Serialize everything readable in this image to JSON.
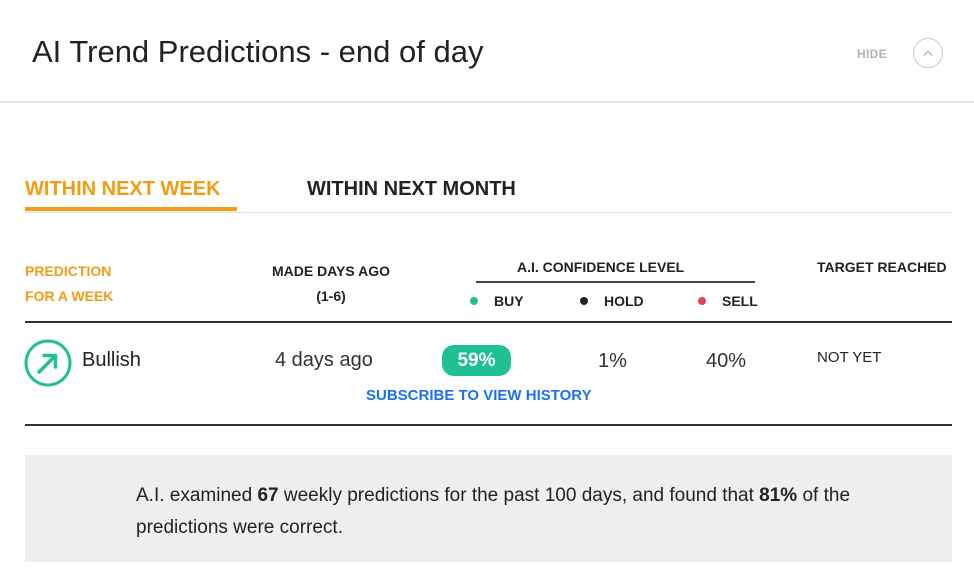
{
  "header": {
    "title": "AI Trend Predictions - end of day",
    "hide_label": "HIDE",
    "collapse_icon": "chevron-up-icon"
  },
  "tabs": [
    {
      "label": "WITHIN NEXT WEEK",
      "active": true
    },
    {
      "label": "WITHIN NEXT MONTH",
      "active": false
    }
  ],
  "columns": {
    "prediction_line1": "PREDICTION",
    "prediction_line2": "FOR A WEEK",
    "made_days_ago_line1": "MADE DAYS AGO",
    "made_days_ago_line2": "(1-6)",
    "confidence": "A.I. CONFIDENCE LEVEL",
    "target": "TARGET REACHED"
  },
  "legend": [
    {
      "label": "BUY",
      "color": "#1fc091"
    },
    {
      "label": "HOLD",
      "color": "#222222"
    },
    {
      "label": "SELL",
      "color": "#e0405a"
    }
  ],
  "row": {
    "trend_icon": "arrow-up-right-circle-icon",
    "trend": "Bullish",
    "made_days_ago": "4 days ago",
    "buy": "59%",
    "hold": "1%",
    "sell": "40%",
    "target_reached": "NOT YET"
  },
  "subscribe_link": "SUBSCRIBE TO VIEW HISTORY",
  "summary": {
    "part1": "A.I. examined ",
    "count": "67",
    "part2": " weekly predictions for the past 100 days, and found that ",
    "accuracy": "81%",
    "part3": " of the predictions were correct."
  },
  "colors": {
    "accent": "#f39c12",
    "bullish": "#1fc091",
    "link": "#1a73e8"
  }
}
